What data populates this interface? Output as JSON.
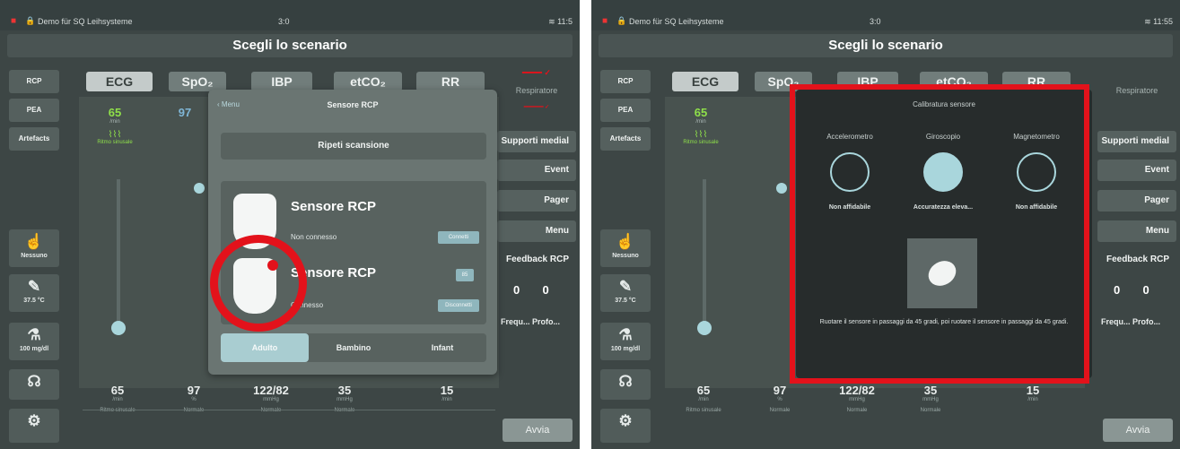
{
  "status_bar": {
    "rec_icon": "record-icon",
    "lock_icon": "lock-icon",
    "app_name": "Demo für SQ Leihsysteme",
    "center": "3:0",
    "right_left": "11:5",
    "right_right": "11:55",
    "wifi_icon": "wifi-icon"
  },
  "title": "Scegli lo scenario",
  "left_menu": [
    "RCP",
    "PEA",
    "Artefacts"
  ],
  "tabs": [
    "ECG",
    "SpO₂",
    "IBP",
    "etCO₂",
    "RR"
  ],
  "vitals_top": {
    "ecg_value": "65",
    "ecg_unit": "/min",
    "ecg_rhythm": "Ritmo sinusale",
    "spo2_value": "97"
  },
  "side_boxes": [
    {
      "icon": "hand-icon",
      "label": "Nessuno"
    },
    {
      "icon": "thermometer-icon",
      "label": "37.5 °C"
    },
    {
      "icon": "glucose-icon",
      "label": "100 mg/dl"
    },
    {
      "icon": "stethoscope-icon",
      "label": ""
    },
    {
      "icon": "settings-icon",
      "label": ""
    }
  ],
  "right_panel": {
    "red_top": "",
    "resp": "Respiratore",
    "supporti": "Supporti medial",
    "event": "Event",
    "pager": "Pager",
    "menu": "Menu",
    "feedback": "Feedback RCP",
    "feedback_vals": [
      "0",
      "0"
    ],
    "freq": "Frequ...",
    "prof": "Profo...",
    "avvia": "Avvia"
  },
  "bottom_vitals": [
    {
      "value": "65",
      "unit": "/min",
      "label": "Ritmo sinusale"
    },
    {
      "value": "97",
      "unit": "%",
      "label": "Normale"
    },
    {
      "value": "122/82",
      "unit": "mmHg",
      "label": "Normale"
    },
    {
      "value": "35",
      "unit": "mmHg",
      "label": "Normale"
    },
    {
      "value": "15",
      "unit": "/min",
      "label": ""
    }
  ],
  "popover": {
    "back": "Menu",
    "title": "Sensore RCP",
    "rescan": "Ripeti scansione",
    "devices": [
      {
        "name": "Sensore RCP",
        "status": "Non connesso",
        "action": "Connetti"
      },
      {
        "name": "Sensore RCP",
        "status": "Connesso",
        "action": "Disconnetti",
        "badge": "85"
      }
    ],
    "segments": [
      "Adulto",
      "Bambino",
      "Infant"
    ]
  },
  "calibration": {
    "title": "Calibratura sensore",
    "sensors": [
      {
        "label": "Accelerometro",
        "status": "Non affidabile",
        "filled": false
      },
      {
        "label": "Giroscopio",
        "status": "Accuratezza eleva...",
        "filled": true
      },
      {
        "label": "Magnetometro",
        "status": "Non affidabile",
        "filled": false
      }
    ],
    "instruction": "Ruotare il sensore in passaggi da 45 gradi, poi ruotare il sensore in passaggi da 45 gradi."
  },
  "colors": {
    "highlight": "#e3121b",
    "accent": "#a9d6dc",
    "ecg_green": "#8fe04a"
  }
}
